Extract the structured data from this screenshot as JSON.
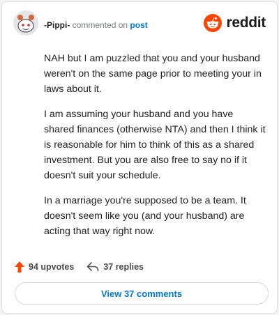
{
  "comment": {
    "username": "-Pippi-",
    "action_text": "commented on",
    "post_link": "post",
    "paragraphs": [
      "NAH but I am puzzled that you and your husband weren't on the same page prior to meeting your in laws about it.",
      "I am assuming your husband and you have shared finances (otherwise NTA) and then I think it is reasonable for him to think of this as a shared investment. But you are also free to say no if it doesn't suit your schedule.",
      "In a marriage you're supposed to be a team. It doesn't seem like you (and your husband) are acting that way right now."
    ],
    "upvotes_label": "94 upvotes",
    "replies_label": "37 replies"
  },
  "brand": {
    "logo_text": "reddit",
    "logo_color": "#ff4500"
  },
  "footer": {
    "view_comments_label": "View 37 comments"
  },
  "icons": {
    "upvote": "upvote-arrow-icon",
    "reply": "reply-arrow-icon",
    "logo": "reddit-snoo-icon"
  }
}
